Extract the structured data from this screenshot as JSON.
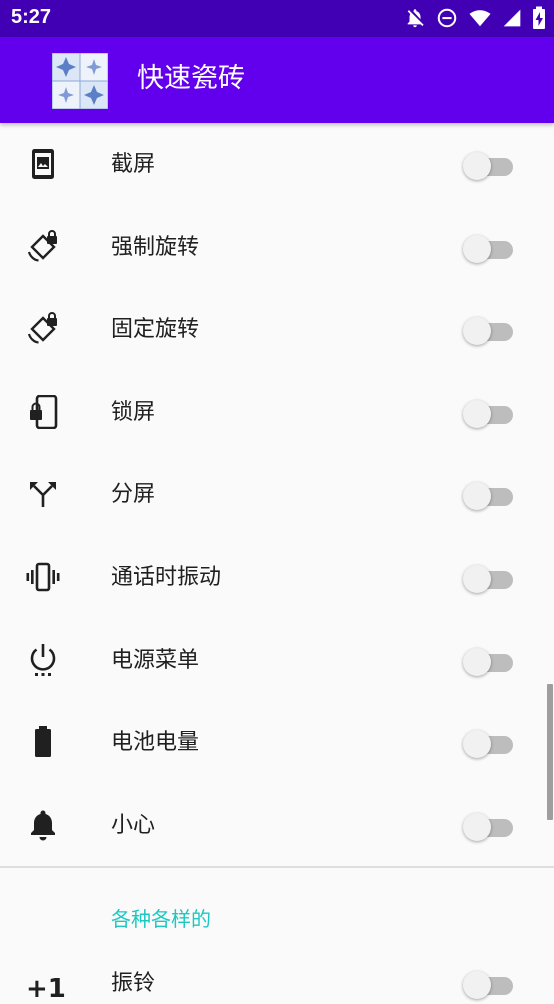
{
  "status_bar": {
    "time": "5:27",
    "icons": [
      "notifications-off-icon",
      "do-not-disturb-icon",
      "wifi-icon",
      "signal-icon",
      "battery-charging-icon"
    ]
  },
  "app_bar": {
    "title": "快速瓷砖",
    "icon": "app-tile-icon"
  },
  "tiles": [
    {
      "label": "截屏",
      "icon": "screenshot-icon",
      "enabled": false
    },
    {
      "label": "强制旋转",
      "icon": "screen-lock-rotation-icon",
      "enabled": false
    },
    {
      "label": "固定旋转",
      "icon": "screen-lock-rotation-icon",
      "enabled": false
    },
    {
      "label": "锁屏",
      "icon": "phone-lock-icon",
      "enabled": false
    },
    {
      "label": "分屏",
      "icon": "split-screen-icon",
      "enabled": false
    },
    {
      "label": "通话时振动",
      "icon": "vibration-icon",
      "enabled": false
    },
    {
      "label": "电源菜单",
      "icon": "power-menu-icon",
      "enabled": false
    },
    {
      "label": "电池电量",
      "icon": "battery-icon",
      "enabled": false
    },
    {
      "label": "小心",
      "icon": "bell-icon",
      "enabled": false
    }
  ],
  "section": {
    "title": "各种各样的"
  },
  "partial_item": {
    "label": "振铃",
    "icon_text": "+1",
    "enabled": false
  },
  "colors": {
    "status_bar": "#4100b3",
    "app_bar": "#6200ee",
    "section_header": "#1ec8c1",
    "switch_track": "#bdbdbd",
    "switch_thumb": "#f1f1f1"
  }
}
